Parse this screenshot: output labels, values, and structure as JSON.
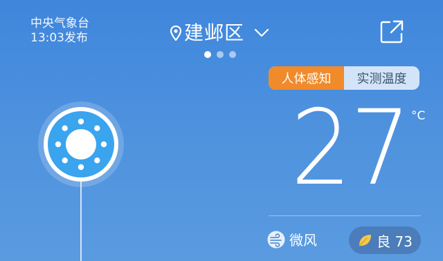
{
  "source": {
    "name": "中央气象台",
    "time": "13:03发布"
  },
  "location": {
    "city": "建邺区",
    "icons": [
      "location-pin-icon",
      "chevron-down-icon"
    ]
  },
  "pager": {
    "count": 3,
    "active_index": 0
  },
  "mode_toggle": {
    "options": [
      "人体感知",
      "实测温度"
    ],
    "selected": "人体感知",
    "active_color": "#f08a2b"
  },
  "weather": {
    "temperature": "27",
    "unit": "°C",
    "condition_icon": "sunny-icon",
    "wind": "微风",
    "aqi_label": "良 73",
    "aqi_icon": "leaf-icon"
  },
  "colors": {
    "background_top": "#3f86dc",
    "background_bottom": "#5a9be0",
    "sun_fill": "#3aa4ee"
  }
}
